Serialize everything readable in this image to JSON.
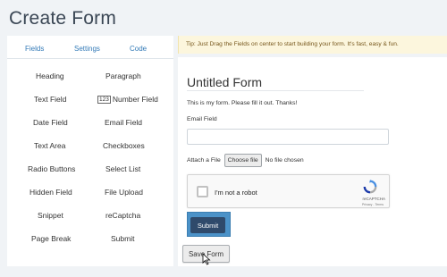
{
  "page": {
    "title": "Create Form"
  },
  "left_panel": {
    "tabs": [
      "Fields",
      "Settings",
      "Code"
    ],
    "fields": [
      "Heading",
      "Paragraph",
      "Text Field",
      "Number Field",
      "Date Field",
      "Email Field",
      "Text Area",
      "Checkboxes",
      "Radio Buttons",
      "Select List",
      "Hidden Field",
      "File Upload",
      "Snippet",
      "reCaptcha",
      "Page Break",
      "Submit"
    ],
    "number_icon_text": "123"
  },
  "tip": {
    "text": "Tip: Just Drag the Fields on center to start building your form. It's fast, easy & fun."
  },
  "form": {
    "title": "Untitled Form",
    "description": "This is my form. Please fill it out. Thanks!",
    "email_label": "Email Field",
    "file_label": "Attach a File",
    "choose_file_label": "Choose file",
    "no_file_text": "No file chosen",
    "recaptcha": {
      "label": "I'm not a robot",
      "brand": "reCAPTCHA",
      "links": "Privacy - Terms"
    },
    "submit_label": "Submit"
  },
  "actions": {
    "save_label": "Save Form"
  },
  "colors": {
    "accent": "#337ab7",
    "submit_bg": "#2f4a6b",
    "submit_frame": "#4b92c8",
    "tip_bg": "#fcf6dd"
  }
}
